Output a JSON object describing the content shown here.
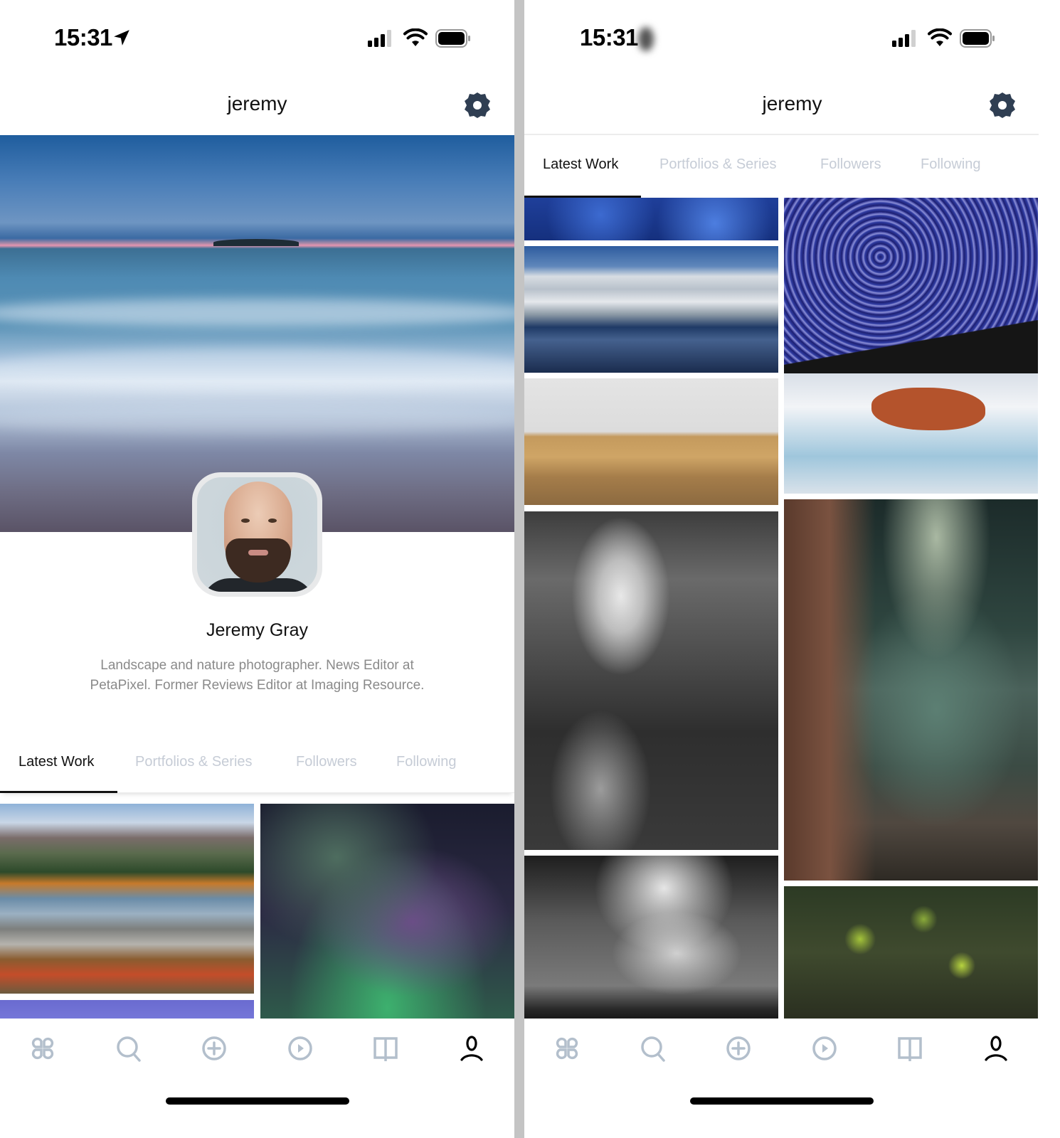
{
  "screens": [
    {
      "status": {
        "time": "15:31",
        "location_icon": "location-arrow-icon"
      },
      "header": {
        "title": "jeremy",
        "settings_icon": "gear-icon"
      },
      "profile": {
        "name": "Jeremy Gray",
        "bio": "Landscape and nature photographer. News Editor at PetaPixel. Former Reviews Editor at Imaging Resource."
      },
      "tabs": [
        {
          "label": "Latest Work",
          "active": true
        },
        {
          "label": "Portfolios & Series",
          "active": false
        },
        {
          "label": "Followers",
          "active": false
        },
        {
          "label": "Following",
          "active": false
        }
      ],
      "photos": [
        {
          "alt": "Autumn mountain lake with boulders"
        },
        {
          "alt": "Green aurora borealis"
        },
        {
          "alt": "Purple twilight sky"
        }
      ]
    },
    {
      "status": {
        "time": "15:31"
      },
      "header": {
        "title": "jeremy",
        "settings_icon": "gear-icon"
      },
      "tabs": [
        {
          "label": "Latest Work",
          "active": true
        },
        {
          "label": "Portfolios & Series",
          "active": false
        },
        {
          "label": "Followers",
          "active": false
        },
        {
          "label": "Following",
          "active": false
        }
      ],
      "photos": [
        {
          "alt": "Blue ice close-up"
        },
        {
          "alt": "Snowy mountain lake reflection"
        },
        {
          "alt": "Golden field with lone tree"
        },
        {
          "alt": "Black and white footbridge and house"
        },
        {
          "alt": "Black and white long-exposure clouds over sea"
        },
        {
          "alt": "Star trails over snowy stream with red rocks"
        },
        {
          "alt": "Milky way over coastal cliffs"
        },
        {
          "alt": "Green leaves foliage"
        }
      ]
    }
  ],
  "tabbar": {
    "items": [
      {
        "name": "feed",
        "icon": "feed-icon",
        "active": false
      },
      {
        "name": "search",
        "icon": "search-icon",
        "active": false
      },
      {
        "name": "add",
        "icon": "add-circle-icon",
        "active": false
      },
      {
        "name": "play",
        "icon": "play-circle-icon",
        "active": false
      },
      {
        "name": "library",
        "icon": "book-icon",
        "active": false
      },
      {
        "name": "profile",
        "icon": "person-icon",
        "active": true
      }
    ]
  },
  "colors": {
    "active_text": "#111111",
    "inactive_tab": "#c6ccd6",
    "tabbar_inactive": "#b3bfcc",
    "gear": "#2f3e52",
    "bio_text": "#8a8a8a"
  }
}
